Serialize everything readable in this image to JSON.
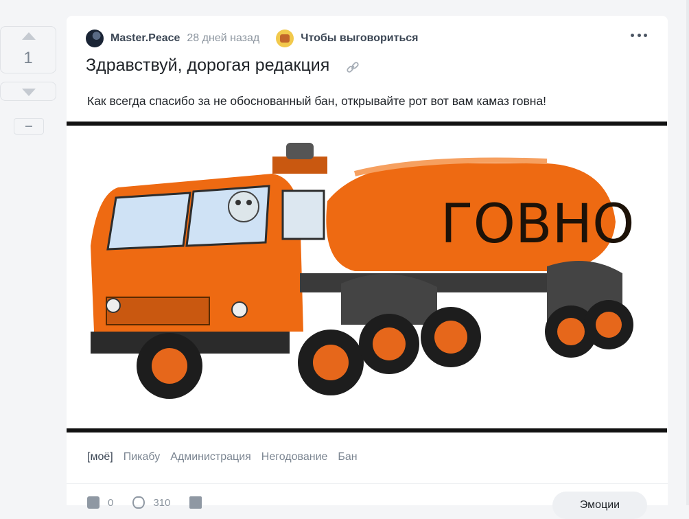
{
  "vote": {
    "count": "1"
  },
  "post": {
    "author": "Master.Peace",
    "time": "28 дней назад",
    "community": "Чтобы выговориться",
    "title": "Здравствуй, дорогая редакция",
    "text": "Как всегда спасибо за не обоснованный бан, открывайте рот вот вам камаз говна!",
    "image_text": "ГОВНО"
  },
  "tags": [
    "[моё]",
    "Пикабу",
    "Администрация",
    "Негодование",
    "Бан"
  ],
  "footer": {
    "comments": "0",
    "views": "310",
    "action_label": "Эмоции"
  },
  "colors": {
    "truck_orange": "#ee6a12",
    "background": "#f4f5f7",
    "card": "#ffffff"
  }
}
